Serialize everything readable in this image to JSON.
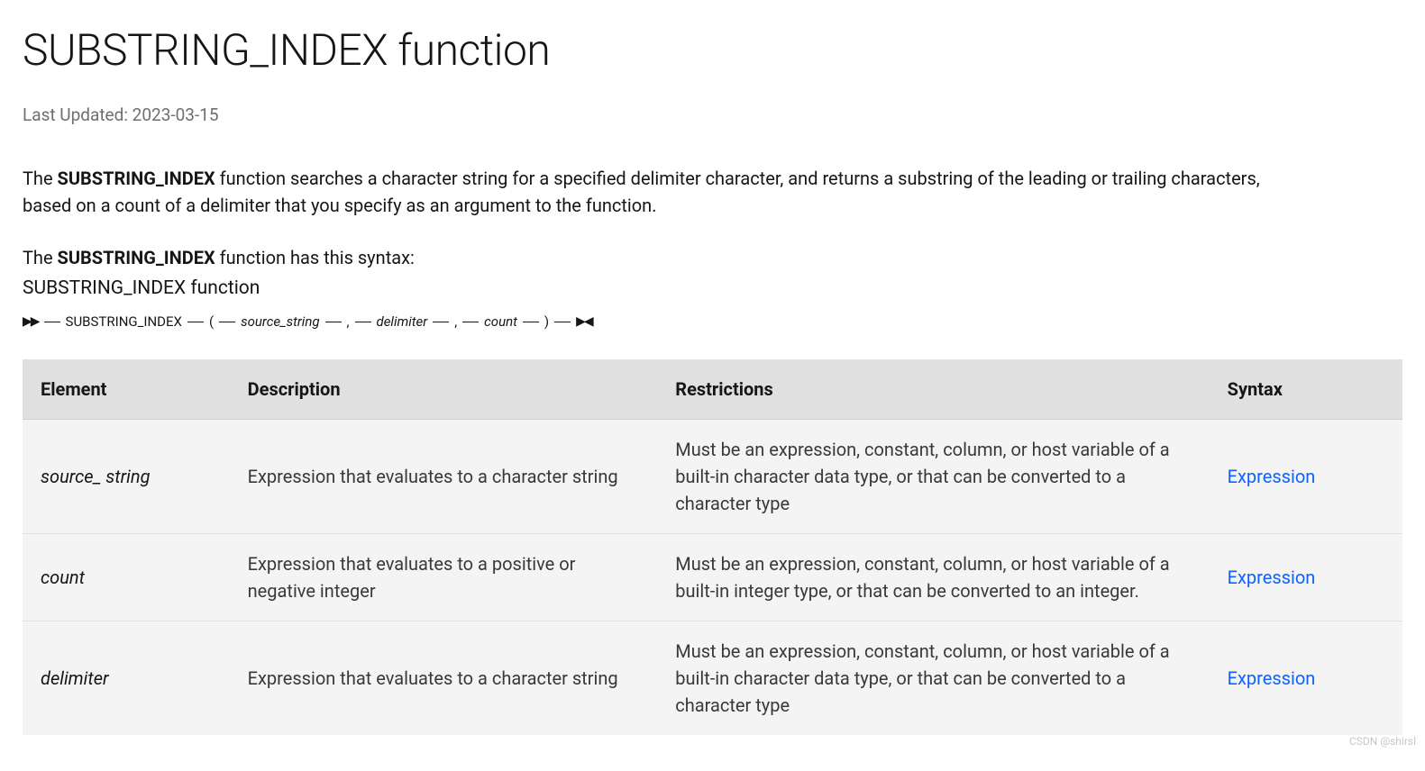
{
  "title": "SUBSTRING_INDEX function",
  "lastUpdated": "Last Updated: 2023-03-15",
  "intro": {
    "prefix": "The ",
    "bold": "SUBSTRING_INDEX",
    "rest": " function searches a character string for a specified delimiter character, and returns a substring of the leading or trailing characters, based on a count of a delimiter that you specify as an argument to the function."
  },
  "syntaxIntro": {
    "prefix": "The ",
    "bold": "SUBSTRING_INDEX",
    "rest": " function has this syntax:"
  },
  "functionLabel": "SUBSTRING_INDEX function",
  "syntax": {
    "keyword": "SUBSTRING_INDEX",
    "open": "(",
    "p1": "source_string",
    "comma": ",",
    "p2": "delimiter",
    "p3": "count",
    "close": ")"
  },
  "table": {
    "headers": [
      "Element",
      "Description",
      "Restrictions",
      "Syntax"
    ],
    "rows": [
      {
        "element": "source_ string",
        "description": "Expression that evaluates to a character string",
        "restrictions": "Must be an expression, constant, column, or host variable of a built-in character data type, or that can be converted to a character type",
        "syntax": "Expression"
      },
      {
        "element": "count",
        "description": "Expression that evaluates to a positive or negative integer",
        "restrictions": "Must be an expression, constant, column, or host variable of a built-in integer type, or that can be converted to an integer.",
        "syntax": "Expression"
      },
      {
        "element": "delimiter",
        "description": "Expression that evaluates to a character string",
        "restrictions": "Must be an expression, constant, column, or host variable of a built-in character data type, or that can be converted to a character type",
        "syntax": "Expression"
      }
    ]
  },
  "watermark": "CSDN @shirsl"
}
